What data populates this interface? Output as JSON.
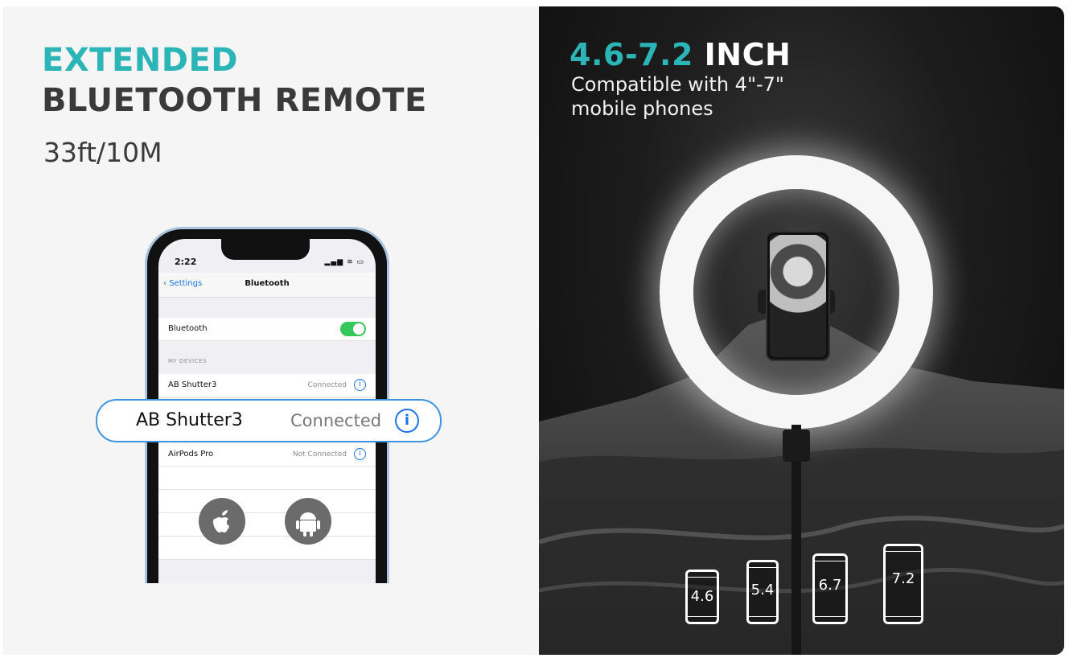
{
  "left_panel": {
    "heading_line1": "EXTENDED",
    "heading_line2": "BLUETOOTH REMOTE",
    "range": "33ft/10M",
    "phone": {
      "time": "2:22",
      "status_icons": "signal wifi battery",
      "back_label": "Settings",
      "nav_title": "Bluetooth",
      "bluetooth_row_label": "Bluetooth",
      "bluetooth_on": true,
      "section_header": "MY DEVICES",
      "devices": [
        {
          "name": "AB Shutter3",
          "status": "Connected"
        },
        {
          "name": "AirPods Pro",
          "status": "Not Connected"
        }
      ],
      "os_icons": [
        "apple-icon",
        "android-icon"
      ]
    },
    "callout": {
      "name": "AB Shutter3",
      "status": "Connected"
    }
  },
  "right_panel": {
    "title_accent": "4.6-7.2",
    "title_rest": "INCH",
    "subtitle": "Compatible with 4\"-7\" mobile phones",
    "phone_sizes": [
      "4.6",
      "5.4",
      "6.7",
      "7.2"
    ]
  },
  "colors": {
    "accent": "#2bb5b7",
    "heading_dark": "#3a3a3a",
    "toggle_on": "#34c759",
    "link_blue": "#1a73e8"
  }
}
